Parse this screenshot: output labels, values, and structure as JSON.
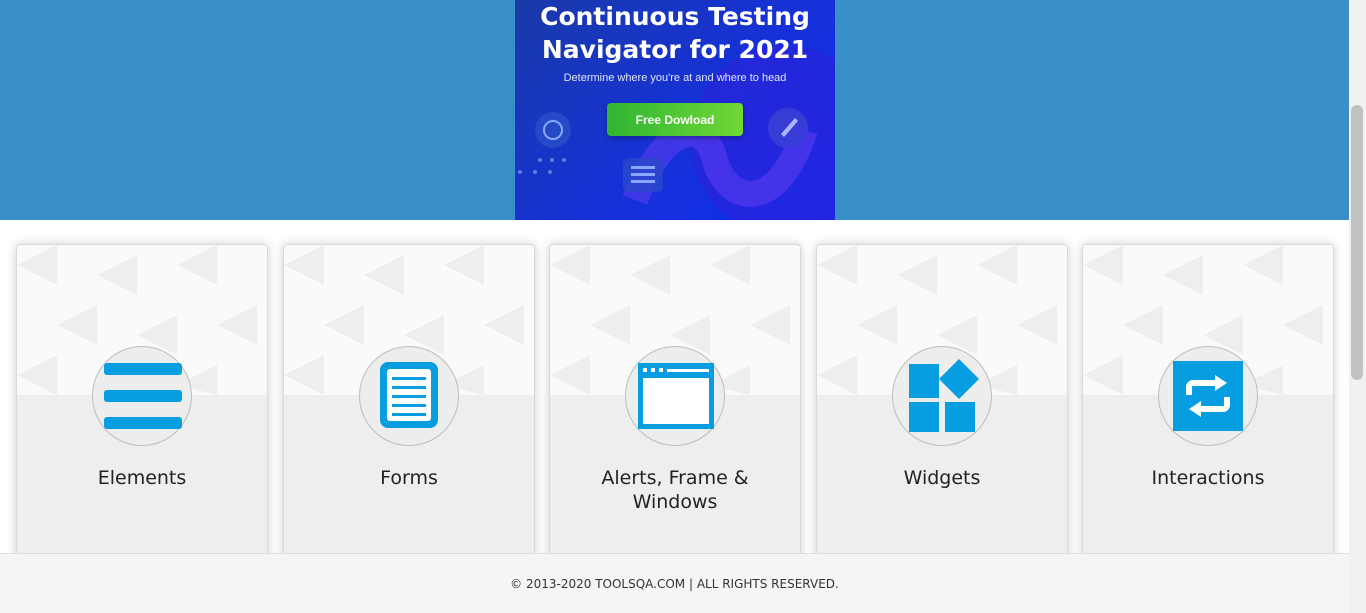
{
  "banner": {
    "title_line1": "Continuous Testing",
    "title_line2": "Navigator for 2021",
    "subtitle": "Determine where you're at and where to head",
    "button_label": "Free Dowload"
  },
  "cards": [
    {
      "title": "Elements",
      "icon": "hamburger-list-icon"
    },
    {
      "title": "Forms",
      "icon": "form-document-icon"
    },
    {
      "title": "Alerts, Frame & Windows",
      "icon": "browser-window-icon"
    },
    {
      "title": "Widgets",
      "icon": "widgets-blocks-icon"
    },
    {
      "title": "Interactions",
      "icon": "swap-arrows-icon"
    }
  ],
  "footer": {
    "copyright": "© 2013-2020 TOOLSQA.COM | ALL RIGHTS RESERVED."
  },
  "colors": {
    "header_bg": "#398fc7",
    "icon_blue": "#069ee0",
    "banner_button": "#43c234"
  }
}
